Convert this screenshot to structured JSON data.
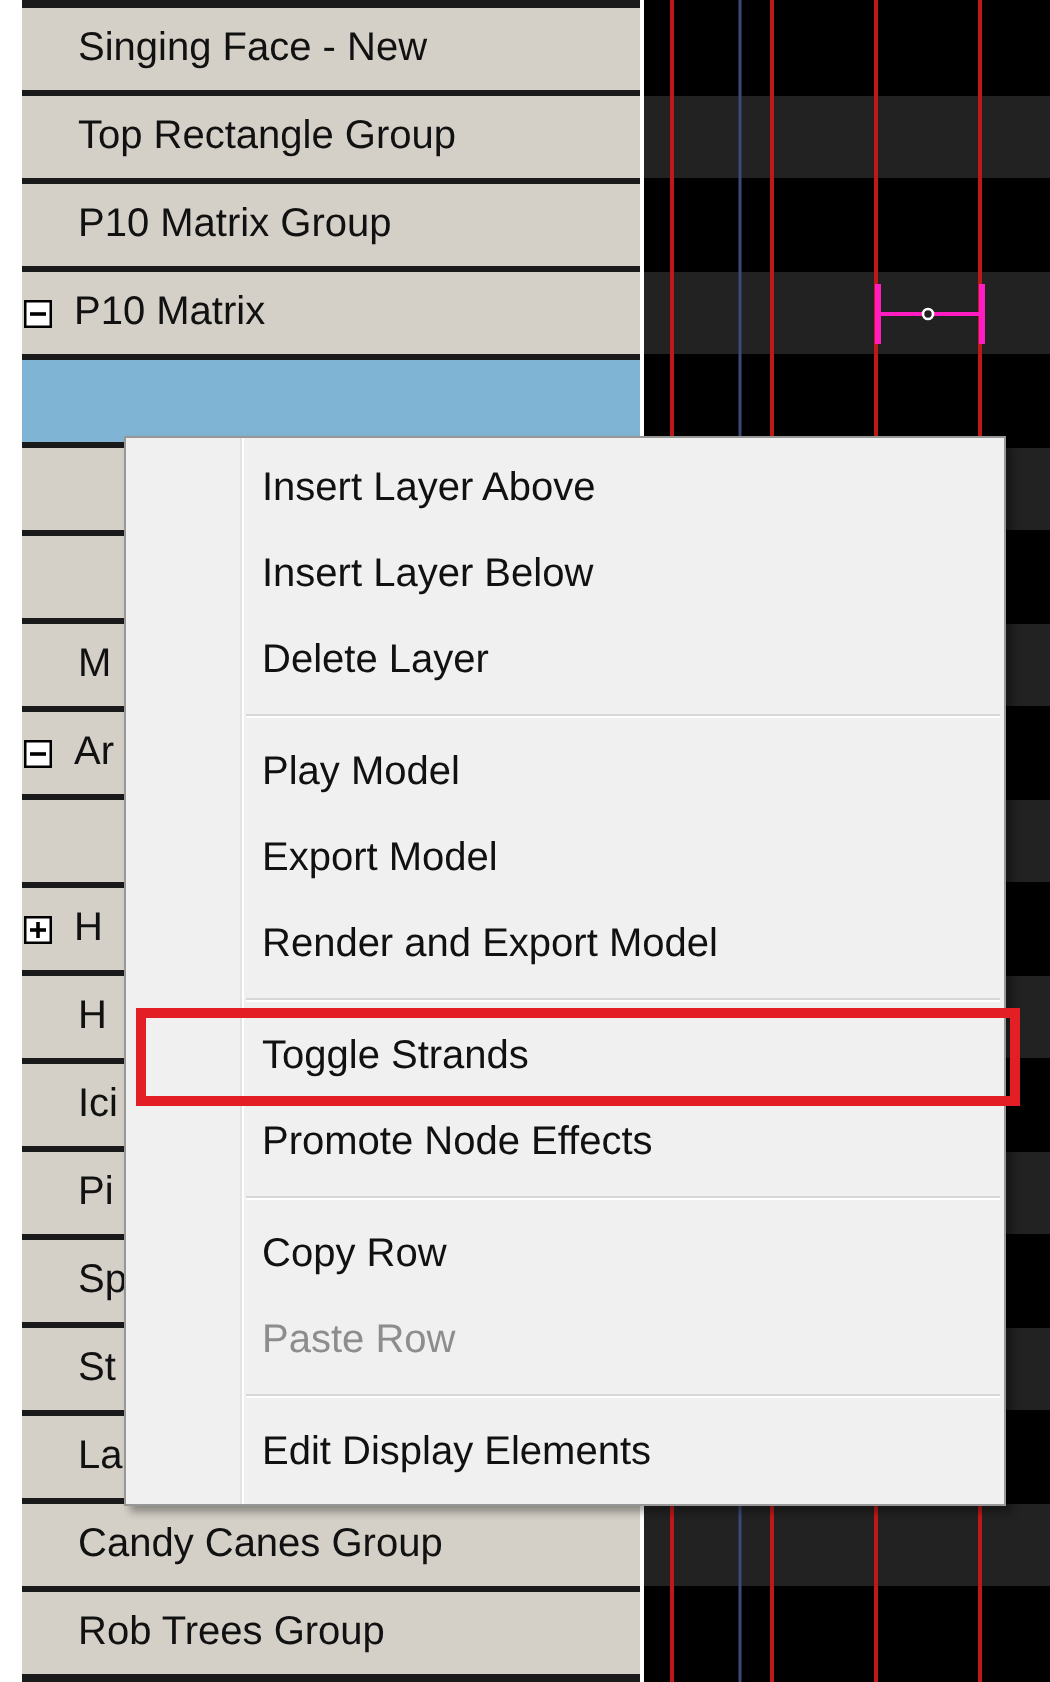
{
  "rows": [
    {
      "label": "Singing Face - New",
      "selected": false
    },
    {
      "label": "Top Rectangle Group",
      "selected": false
    },
    {
      "label": "P10 Matrix Group",
      "selected": false
    },
    {
      "label": "P10 Matrix",
      "selected": false,
      "expanded": true
    },
    {
      "label": "",
      "selected": true
    },
    {
      "label": "",
      "selected": false
    },
    {
      "label": "",
      "selected": false
    },
    {
      "label": "M",
      "selected": false
    },
    {
      "label": "Ar",
      "selected": false,
      "expanded": true
    },
    {
      "label": "",
      "selected": false
    },
    {
      "label": "H",
      "selected": false,
      "expanded": false
    },
    {
      "label": "H",
      "selected": false
    },
    {
      "label": "Ici",
      "selected": false
    },
    {
      "label": "Pi",
      "selected": false
    },
    {
      "label": "Sp",
      "selected": false
    },
    {
      "label": "St",
      "selected": false
    },
    {
      "label": "La",
      "selected": false
    },
    {
      "label": "Candy Canes Group",
      "selected": false
    },
    {
      "label": "Rob Trees Group",
      "selected": false
    }
  ],
  "context_menu": [
    {
      "kind": "item",
      "label": "Insert Layer Above",
      "disabled": false,
      "highlighted": false
    },
    {
      "kind": "item",
      "label": "Insert Layer Below",
      "disabled": false,
      "highlighted": false
    },
    {
      "kind": "item",
      "label": "Delete Layer",
      "disabled": false,
      "highlighted": false
    },
    {
      "kind": "separator"
    },
    {
      "kind": "item",
      "label": "Play Model",
      "disabled": false,
      "highlighted": false
    },
    {
      "kind": "item",
      "label": "Export Model",
      "disabled": false,
      "highlighted": false
    },
    {
      "kind": "item",
      "label": "Render and Export Model",
      "disabled": false,
      "highlighted": false
    },
    {
      "kind": "separator"
    },
    {
      "kind": "item",
      "label": "Toggle Strands",
      "disabled": false,
      "highlighted": true
    },
    {
      "kind": "item",
      "label": "Promote Node Effects",
      "disabled": false,
      "highlighted": false
    },
    {
      "kind": "separator"
    },
    {
      "kind": "item",
      "label": "Copy Row",
      "disabled": false,
      "highlighted": false
    },
    {
      "kind": "item",
      "label": "Paste Row",
      "disabled": true,
      "highlighted": false
    },
    {
      "kind": "separator"
    },
    {
      "kind": "item",
      "label": "Edit Display Elements",
      "disabled": false,
      "highlighted": false
    }
  ]
}
